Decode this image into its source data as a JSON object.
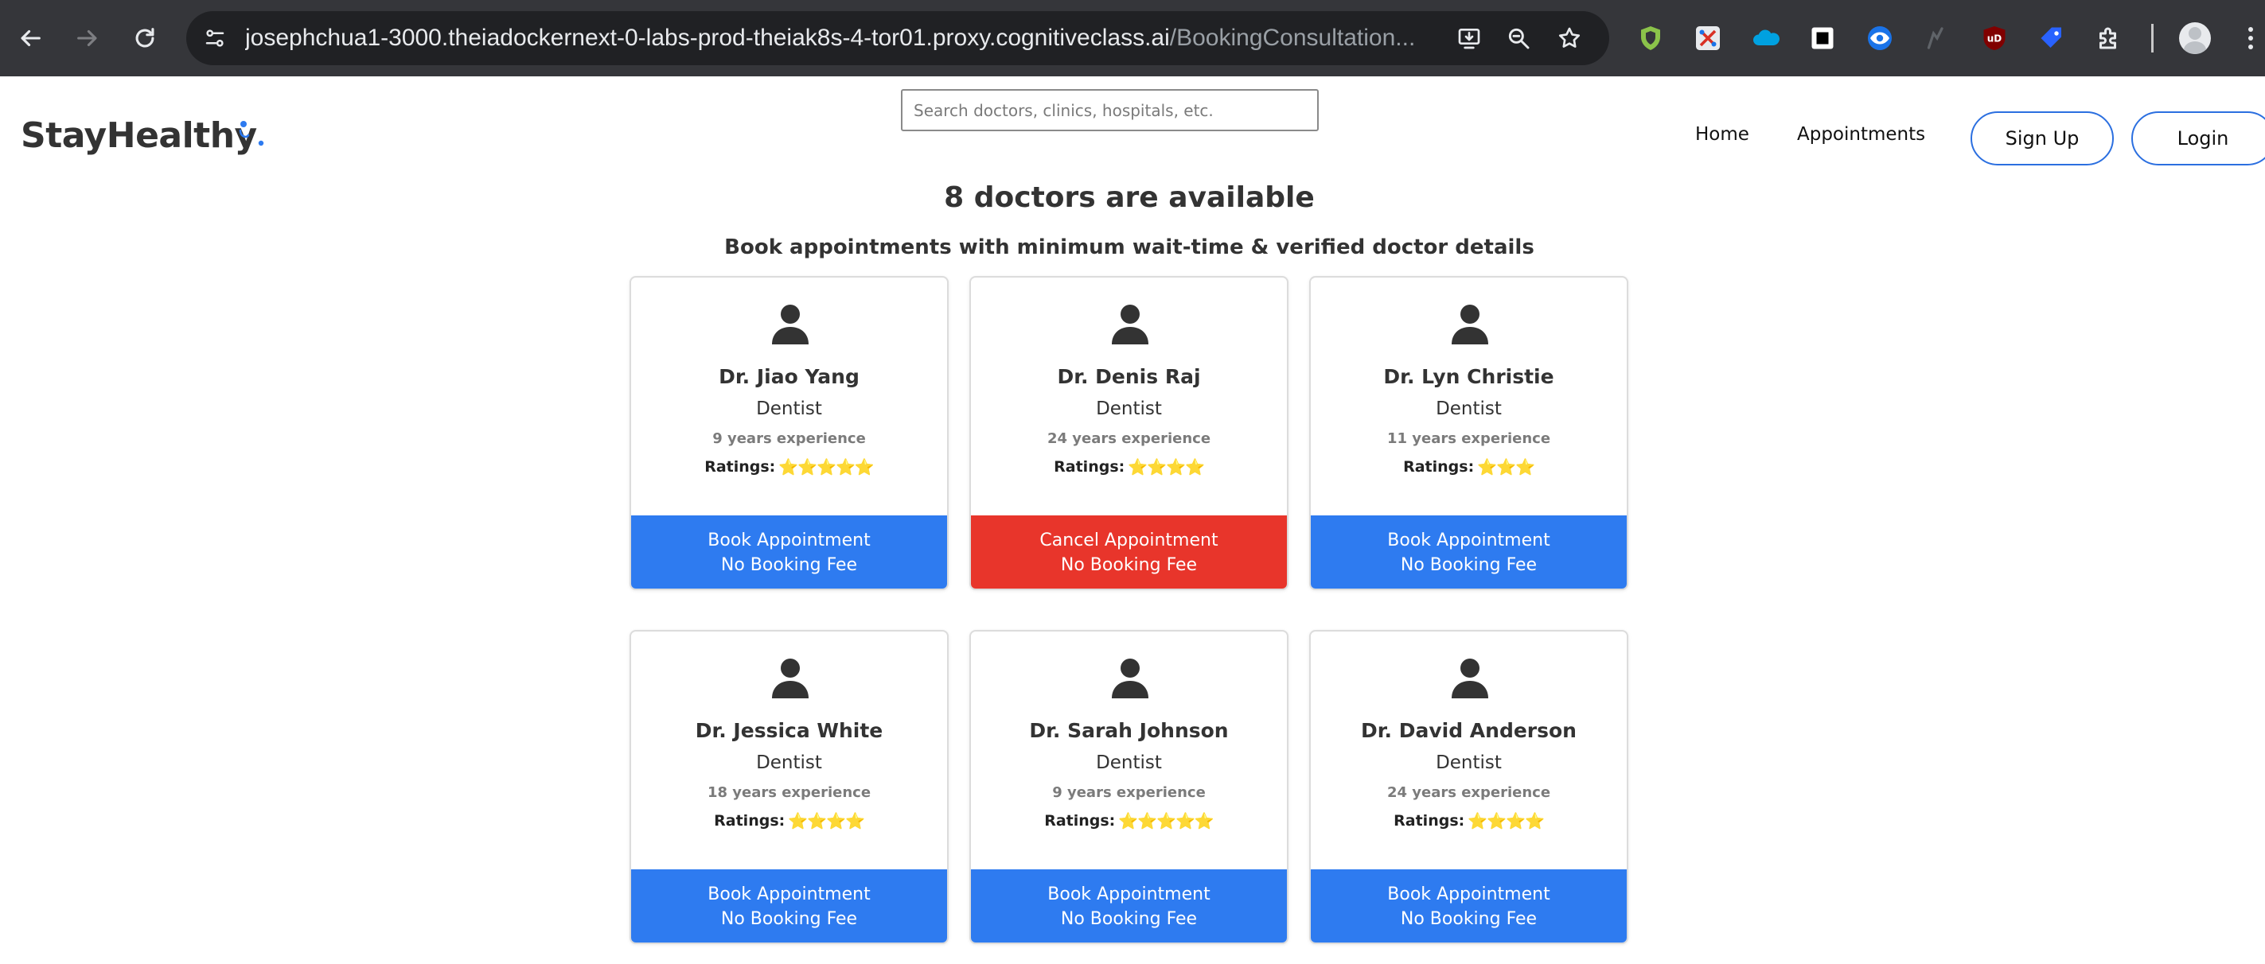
{
  "browser": {
    "url_host": "josephchua1-3000.theiadockernext-0-labs-prod-theiak8s-4-tor01.proxy.cognitiveclass.ai",
    "url_path": "/BookingConsultation...",
    "icons": [
      "back-icon",
      "forward-icon",
      "reload-icon",
      "site-info-icon",
      "install-app-icon",
      "zoom-icon",
      "bookmark-star-icon",
      "puzzle-extensions-icon",
      "profile-avatar-icon",
      "more-menu-icon"
    ],
    "extensions": [
      "shield-extension-icon",
      "scissors-extension-icon",
      "salesforce-extension-icon",
      "square-extension-icon",
      "eye-extension-icon",
      "pen-extension-icon",
      "ublock-extension-icon",
      "tag-extension-icon"
    ]
  },
  "header": {
    "brand": "StayHealthy",
    "search_placeholder": "Search doctors, clinics, hospitals, etc.",
    "nav": {
      "home": "Home",
      "appointments": "Appointments"
    },
    "signup_label": "Sign Up",
    "login_label": "Login"
  },
  "main": {
    "heading": "8 doctors are available",
    "subheading": "Book appointments with minimum wait-time & verified doctor details",
    "ratings_label": "Ratings:",
    "doctors": [
      {
        "name": "Dr. Jiao Yang",
        "speciality": "Dentist",
        "experience": "9 years experience",
        "stars": "⭐⭐⭐⭐⭐",
        "rating": 5,
        "action_line1": "Book Appointment",
        "action_line2": "No Booking Fee",
        "action_state": "book"
      },
      {
        "name": "Dr. Denis Raj",
        "speciality": "Dentist",
        "experience": "24 years experience",
        "stars": "⭐⭐⭐⭐",
        "rating": 4,
        "action_line1": "Cancel Appointment",
        "action_line2": "No Booking Fee",
        "action_state": "cancel"
      },
      {
        "name": "Dr. Lyn Christie",
        "speciality": "Dentist",
        "experience": "11 years experience",
        "stars": "⭐⭐⭐",
        "rating": 3,
        "action_line1": "Book Appointment",
        "action_line2": "No Booking Fee",
        "action_state": "book"
      },
      {
        "name": "Dr. Jessica White",
        "speciality": "Dentist",
        "experience": "18 years experience",
        "stars": "⭐⭐⭐⭐",
        "rating": 4,
        "action_line1": "Book Appointment",
        "action_line2": "No Booking Fee",
        "action_state": "book"
      },
      {
        "name": "Dr. Sarah Johnson",
        "speciality": "Dentist",
        "experience": "9 years experience",
        "stars": "⭐⭐⭐⭐⭐",
        "rating": 5,
        "action_line1": "Book Appointment",
        "action_line2": "No Booking Fee",
        "action_state": "book"
      },
      {
        "name": "Dr. David Anderson",
        "speciality": "Dentist",
        "experience": "24 years experience",
        "stars": "⭐⭐⭐⭐",
        "rating": 4,
        "action_line1": "Book Appointment",
        "action_line2": "No Booking Fee",
        "action_state": "book"
      }
    ]
  },
  "colors": {
    "chrome_bg": "#35363a",
    "omnibox_bg": "#202124",
    "primary_blue": "#2e7bf0",
    "cancel_red": "#e8352b",
    "text_dark": "#333333",
    "text_muted": "#7b7b7b",
    "star": "#f5c518"
  }
}
